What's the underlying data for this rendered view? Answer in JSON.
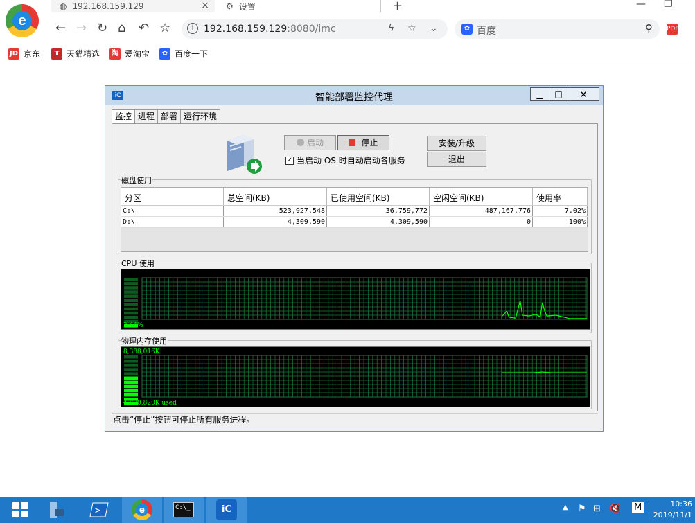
{
  "browser": {
    "tabs": [
      {
        "title": "192.168.159.129"
      },
      {
        "title": "设置"
      }
    ],
    "address": {
      "host": "192.168.159.129",
      "rest": ":8080/imc"
    },
    "search_placeholder": "百度",
    "bookmarks": [
      {
        "label": "京东",
        "icon": "jd-icon",
        "badge": "JD",
        "color": "#e53935"
      },
      {
        "label": "天猫精选",
        "icon": "tmall-icon",
        "badge": "T",
        "color": "#c62828"
      },
      {
        "label": "爱淘宝",
        "icon": "taobao-icon",
        "badge": "淘",
        "color": "#e53935"
      },
      {
        "label": "百度一下",
        "icon": "baidu-icon",
        "badge": "✿",
        "color": "#2962ff"
      }
    ]
  },
  "app": {
    "title": "智能部署监控代理",
    "tabs": [
      "监控",
      "进程",
      "部署",
      "运行环境"
    ],
    "buttons": {
      "start": "启动",
      "stop": "停止",
      "install": "安装/升级",
      "exit": "退出"
    },
    "autostart_label": "当启动 OS 时自动启动各服务",
    "disk": {
      "group_label": "磁盘使用",
      "columns": [
        "分区",
        "总空间(KB)",
        "已使用空间(KB)",
        "空闲空间(KB)",
        "使用率"
      ],
      "rows": [
        [
          "C:\\",
          "523,927,548",
          "36,759,772",
          "487,167,776",
          "7.02%"
        ],
        [
          "D:\\",
          "4,309,590",
          "4,309,590",
          "0",
          "100%"
        ]
      ]
    },
    "cpu": {
      "group_label": "CPU 使用",
      "value": "2.44%",
      "level": 0.0244
    },
    "memory": {
      "group_label": "物理内存使用",
      "total": "8,388,016K",
      "used": "4,890,820K used",
      "level": 0.583
    },
    "status": "点击“停止”按钮可停止所有服务进程。"
  },
  "taskbar": {
    "time": "10:36",
    "date": "2019/11/1",
    "ime": "M"
  },
  "colors": {
    "graph_green": "#00ff00",
    "grid_green": "#1f7a3a",
    "accent_blue": "#1f78c8"
  }
}
